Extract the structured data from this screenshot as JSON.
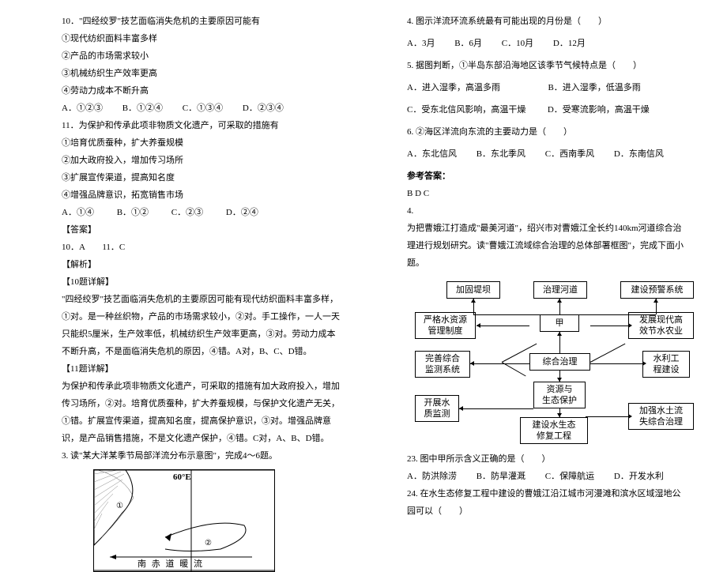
{
  "left": {
    "q10_stem": "10．\"四经绞罗\"技艺面临消失危机的主要原因可能有",
    "q10_op1": "①现代纺织面料丰富多样",
    "q10_op2": "②产品的市场需求较小",
    "q10_op3": "③机械纺织生产效率更高",
    "q10_op4": "④劳动力成本不断升高",
    "q10_choices": {
      "a": "A．①②③",
      "b": "B．①②④",
      "c": "C．①③④",
      "d": "D．②③④"
    },
    "q11_stem": "11．为保护和传承此项非物质文化遗产，可采取的措施有",
    "q11_op1": "①培育优质蚕种，扩大养蚕规模",
    "q11_op2": "②加大政府投入，增加传习场所",
    "q11_op3": "③扩展宣传渠道，提高知名度",
    "q11_op4": "④增强品牌意识，拓宽销售市场",
    "q11_choices": {
      "a": "A．①④",
      "b": "B．①②",
      "c": "C．②③",
      "d": "D．②④"
    },
    "ans_h": "【答案】",
    "ans_t": "10．A　　11．C",
    "jx_h": "【解析】",
    "jx10_h": "【10题详解】",
    "jx10_t": "\"四经绞罗\"技艺面临消失危机的主要原因可能有现代纺织面料丰富多样，①对。是一种丝织物，产品的市场需求较小，②对。手工操作，一人一天只能织5厘米，生产效率低，机械纺织生产效率更高，③对。劳动力成本不断升高，不是面临消失危机的原因，④错。A对，B、C、D错。",
    "jx11_h": "【11题详解】",
    "jx11_t": "为保护和传承此项非物质文化遗产，可采取的措施有加大政府投入，增加传习场所，②对。培育优质蚕种，扩大养蚕规模，与保护文化遗产无关，①错。扩展宣传渠道，提高知名度，提高保护意识，③对。增强品牌意识，是产品销售措施，不是文化遗产保护，④错。C对，A、B、D错。",
    "q3_stem": "3. 读\"某大洋某季节局部洋流分布示意图\"，完成4～6题。",
    "map_lon": "60°E",
    "map_equator": "南 赤 道 暖 流",
    "map_marks": {
      "m1": "①",
      "m2": "②"
    }
  },
  "right": {
    "q4_stem": "4. 图示洋流环流系统最有可能出现的月份是（　　）",
    "q4_choices": {
      "a": "A．3月",
      "b": "B．6月",
      "c": "C．10月",
      "d": "D．12月"
    },
    "q5_stem": "5. 据图判断，①半岛东部沿海地区该季节气候特点是（　　）",
    "q5_choices": {
      "a": "A．进入湿季，高温多雨",
      "b": "B．进入湿季，低温多雨",
      "c": "C．受东北信风影响，高温干燥",
      "d": "D．受寒流影响，高温干燥"
    },
    "q6_stem": "6. ②海区洋流向东流的主要动力是（　　）",
    "q6_choices": {
      "a": "A．东北信风",
      "b": "B．东北季风",
      "c": "C．西南季风",
      "d": "D．东南信风"
    },
    "refans_h": "参考答案：",
    "refans_t": "B D C",
    "grp4": "4.",
    "grp4_para": "为把曹娥江打造成\"最美河道\"，绍兴市对曹娥江全长约140km河道综合治理进行规划研究。读\"曹娥江流域综合治理的总体部署框图\"，完成下面小题。",
    "d": {
      "b1": "加固堤坝",
      "b2": "治理河道",
      "b3": "建设预警系统",
      "b4": "严格水资源\n管理制度",
      "b5": "甲",
      "b6": "发展现代高\n效节水农业",
      "b7": "完善综合\n监测系统",
      "b8": "综合治理",
      "b9": "水利工\n程建设",
      "b10": "开展水\n质监测",
      "b11": "资源与\n生态保护",
      "b12": "建设水生态\n修复工程",
      "b13": "加强水土流\n失综合治理"
    },
    "q23_stem": "23. 图中甲所示含义正确的是（　　）",
    "q23_choices": {
      "a": "A．防洪除涝",
      "b": "B．防旱灌溉",
      "c": "C．保障航运",
      "d": "D．开发水利"
    },
    "q24_stem": "24. 在水生态修复工程中建设的曹娥江沿江城市河漫滩和滨水区域湿地公园可以（　　）"
  }
}
